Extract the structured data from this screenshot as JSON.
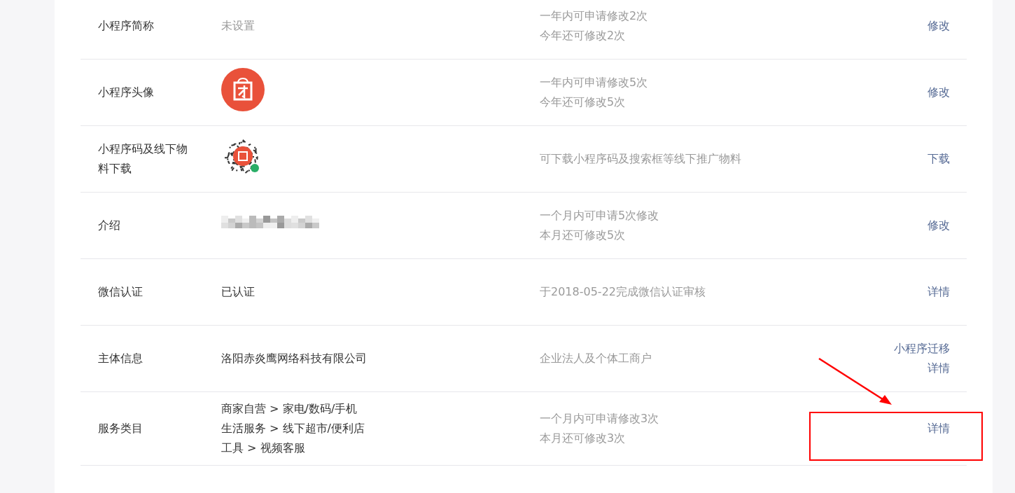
{
  "rows": [
    {
      "label": "小程序简称",
      "kind": "text",
      "muted": true,
      "value": [
        "未设置"
      ],
      "notes": [
        "一年内可申请修改2次",
        "今年还可修改2次"
      ],
      "actions": [
        "修改"
      ],
      "highlighted": false
    },
    {
      "label": "小程序头像",
      "kind": "avatar",
      "notes": [
        "一年内可申请修改5次",
        "今年还可修改5次"
      ],
      "actions": [
        "修改"
      ],
      "highlighted": false
    },
    {
      "label": "小程序码及线下物料下载",
      "kind": "qr",
      "notes": [
        "可下载小程序码及搜索框等线下推广物料"
      ],
      "actions": [
        "下载"
      ],
      "highlighted": false
    },
    {
      "label": "介绍",
      "kind": "redacted",
      "notes": [
        "一个月内可申请5次修改",
        "本月还可修改5次"
      ],
      "actions": [
        "修改"
      ],
      "highlighted": false
    },
    {
      "label": "微信认证",
      "kind": "text",
      "muted": false,
      "value": [
        "已认证"
      ],
      "notes": [
        "于2018-05-22完成微信认证审核"
      ],
      "actions": [
        "详情"
      ],
      "highlighted": false
    },
    {
      "label": "主体信息",
      "kind": "text",
      "muted": false,
      "value": [
        "洛阳赤炎鹰网络科技有限公司"
      ],
      "notes": [
        "企业法人及个体工商户"
      ],
      "actions": [
        "小程序迁移",
        "详情"
      ],
      "highlighted": false
    },
    {
      "label": "服务类目",
      "kind": "text",
      "muted": false,
      "value": [
        "商家自营 > 家电/数码/手机",
        "生活服务 > 线下超市/便利店",
        "工具 > 视频客服"
      ],
      "notes": [
        "一个月内可申请修改3次",
        "本月还可修改3次"
      ],
      "actions": [
        "详情"
      ],
      "highlighted": true
    }
  ]
}
